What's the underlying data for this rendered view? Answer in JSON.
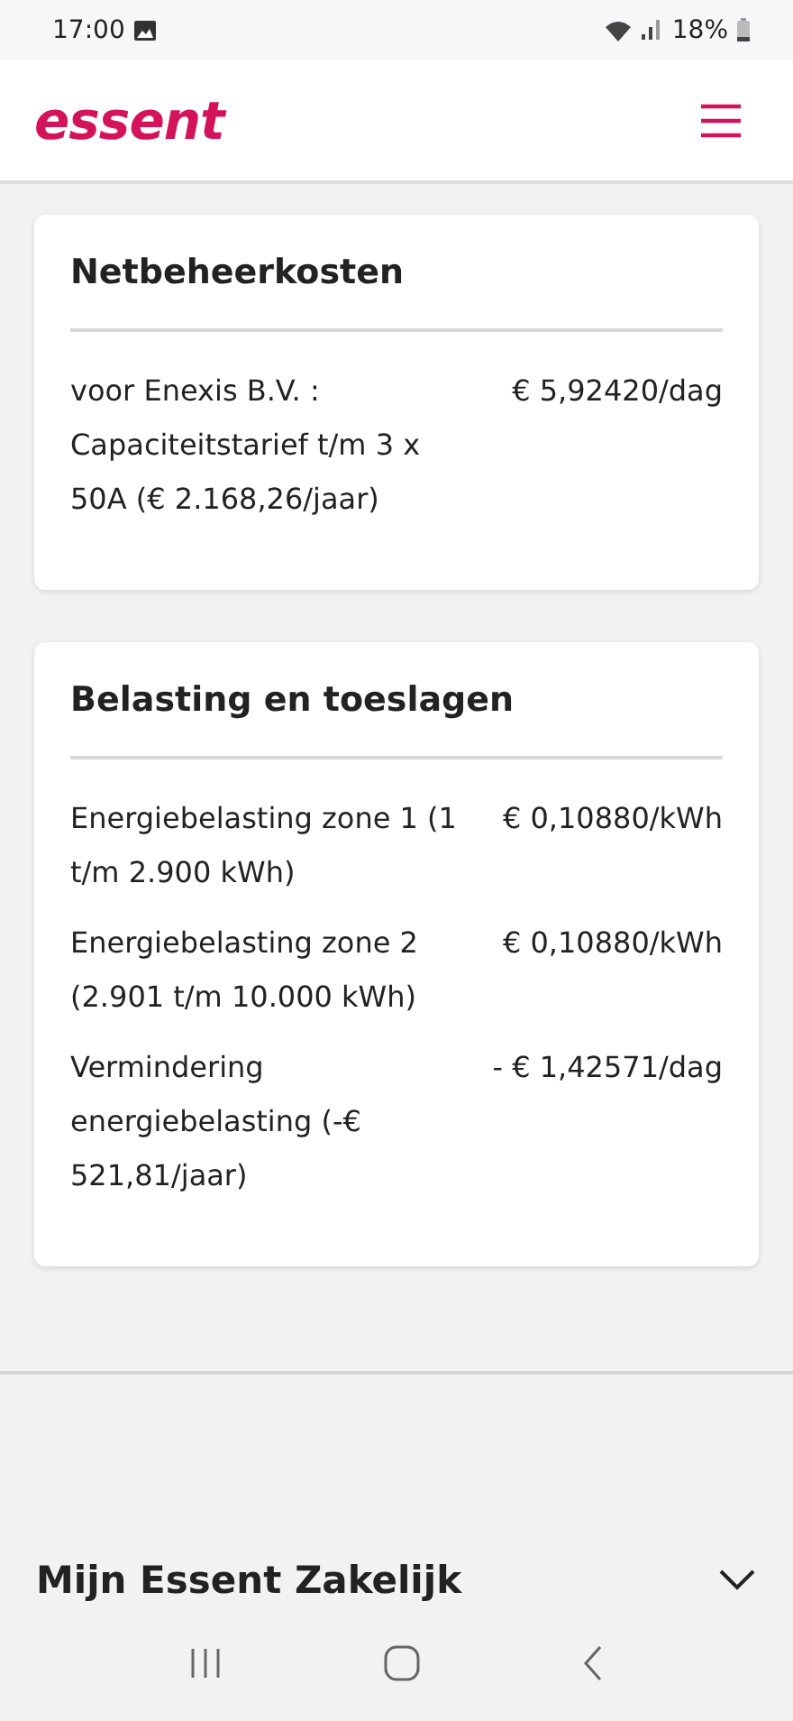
{
  "status_bar": {
    "time": "17:00",
    "battery": "18%"
  },
  "header": {
    "logo": "essent"
  },
  "cards": [
    {
      "title": "Netbeheerkosten",
      "rows": [
        {
          "label": "voor Enexis B.V. : Capaciteitstarief t/m 3 x 50A (€ 2.168,26/jaar)",
          "value": "€ 5,92420/dag"
        }
      ]
    },
    {
      "title": "Belasting en toeslagen",
      "rows": [
        {
          "label": "Energiebelasting zone 1 (1 t/m 2.900 kWh)",
          "value": "€ 0,10880/kWh"
        },
        {
          "label": "Energiebelasting zone 2 (2.901 t/m 10.000 kWh)",
          "value": "€ 0,10880/kWh"
        },
        {
          "label": "Vermindering energiebelasting (-€ 521,81/jaar)",
          "value": "- € 1,42571/dag"
        }
      ]
    }
  ],
  "footer_section": {
    "title": "Mijn Essent Zakelijk",
    "expanded": false
  }
}
